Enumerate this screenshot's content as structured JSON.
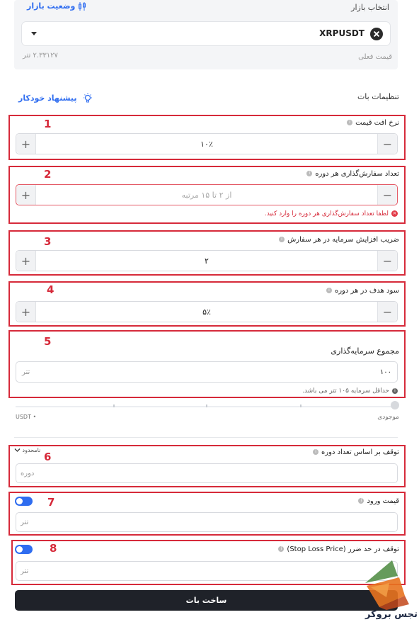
{
  "market": {
    "label": "انتخاب بازار",
    "status_link": "وضعیت بازار",
    "selected": "XRPUSDT",
    "current_price_label": "قیمت فعلی",
    "current_price_value": "۲.۳۳۱۲۷ تتر"
  },
  "settings": {
    "title": "تنظیمات بات",
    "auto_suggest": "پیشنهاد خودکار"
  },
  "fields": {
    "price_drop": {
      "num": "1",
      "label": "نرخ افت قیمت",
      "value": "۱۰٪",
      "plus": "+",
      "minus": "−"
    },
    "orders_per_cycle": {
      "num": "2",
      "label": "تعداد سفارش‌گذاری هر دوره",
      "placeholder": "از ۲ تا ۱۵ مرتبه",
      "error": "لطفا تعداد سفارش‌گذاری هر دوره را وارد کنید.",
      "plus": "+",
      "minus": "−"
    },
    "capital_multiplier": {
      "num": "3",
      "label": "ضریب افزایش سرمایه در هر سفارش",
      "value": "۲",
      "plus": "+",
      "minus": "−"
    },
    "target_profit": {
      "num": "4",
      "label": "سود هدف در هر دوره",
      "value": "۵٪",
      "plus": "+",
      "minus": "−"
    },
    "total_investment": {
      "num": "5",
      "label": "مجموع سرمایه‌گذاری",
      "value": "۱۰۰",
      "unit": "تتر",
      "hint": "حداقل سرمایه ۱۰۵ تتر می باشد."
    },
    "balance": {
      "label": "موجودی",
      "unit": "USDT"
    },
    "stop_cycles": {
      "num": "6",
      "label": "توقف بر اساس تعداد دوره",
      "dropdown": "نامحدود",
      "placeholder": "دوره"
    },
    "entry_price": {
      "num": "7",
      "label": "قیمت ورود",
      "placeholder": "تتر"
    },
    "stop_loss": {
      "num": "8",
      "label": "توقف در حد ضرر (Stop Loss Price)",
      "placeholder": "تتر"
    }
  },
  "actions": {
    "create_bot": "ساخت بات"
  },
  "watermark": {
    "text": "تجس بروکر"
  },
  "colors": {
    "accent": "#2f6df0",
    "annotation_red": "#d62a3a",
    "button_dark": "#1f2229",
    "error": "#e23a48"
  }
}
